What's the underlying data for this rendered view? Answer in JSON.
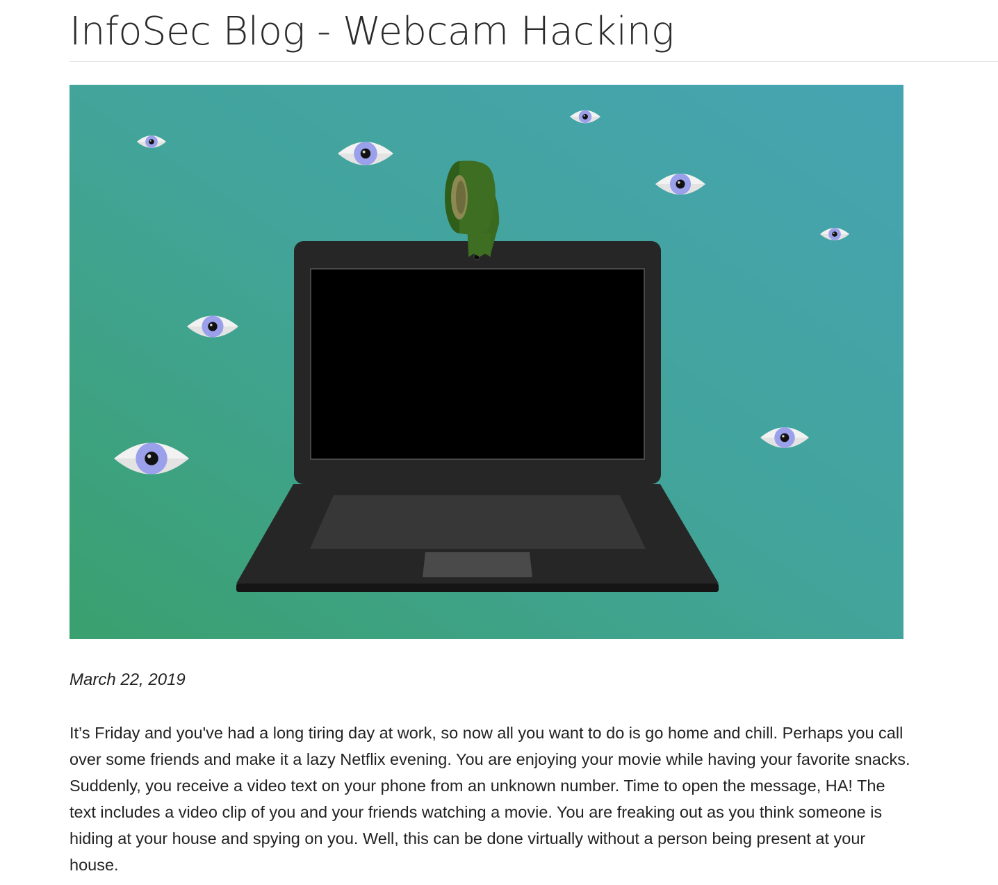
{
  "page": {
    "title": "InfoSec Blog - Webcam Hacking"
  },
  "hero": {
    "background_gradient": [
      "#3aa06e",
      "#42a49a",
      "#46a4b2"
    ],
    "laptop_color": "#262626",
    "screen_color": "#000000",
    "tape_color": "#3d6e22",
    "eye_iris_color": "#9aa0ea",
    "eye_white_color": "#f2f2f2"
  },
  "post": {
    "date": "March 22, 2019",
    "body": "It’s Friday and you've had a long tiring day at work, so now all you want to do is go home and chill. Perhaps you call over some friends and make it a lazy Netflix evening. You are enjoying your movie while having your favorite snacks. Suddenly, you receive a video text on your phone from an unknown number. Time to open the message, HA! The text includes a video clip of you and your friends watching a movie. You are freaking out as you think someone is hiding at your house and spying on you. Well, this can be done virtually without a person being present at your house."
  }
}
